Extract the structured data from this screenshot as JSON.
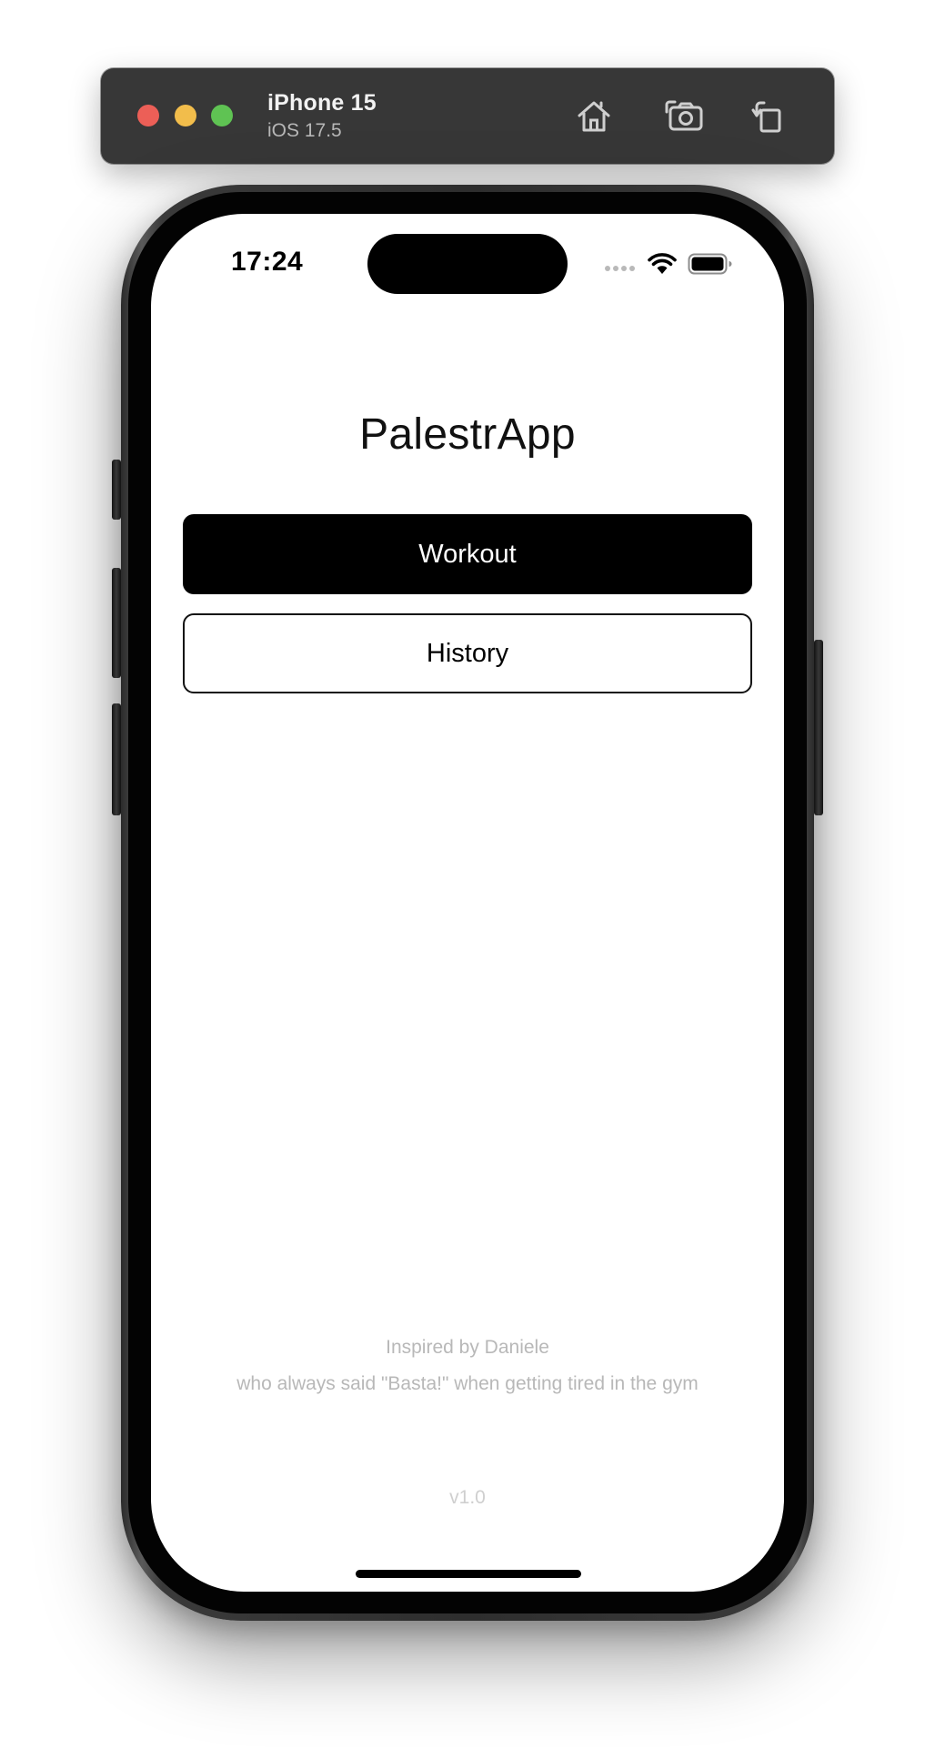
{
  "simulator": {
    "device_name": "iPhone 15",
    "os_version": "iOS 17.5",
    "traffic_lights": {
      "close_color": "#ec5f57",
      "minimize_color": "#f2bd4b",
      "zoom_color": "#5fc353"
    },
    "toolbar_icons": [
      "home-icon",
      "screenshot-icon",
      "rotate-icon"
    ]
  },
  "status_bar": {
    "time": "17:24",
    "icons": [
      "signal-dots-icon",
      "wifi-icon",
      "battery-icon"
    ]
  },
  "app": {
    "title": "PalestrApp",
    "buttons": {
      "workout": "Workout",
      "history": "History"
    },
    "footer": {
      "inspired_by": "Inspired by Daniele",
      "quote": "who always said \"Basta!\" when getting tired in the gym",
      "version": "v1.0"
    }
  }
}
